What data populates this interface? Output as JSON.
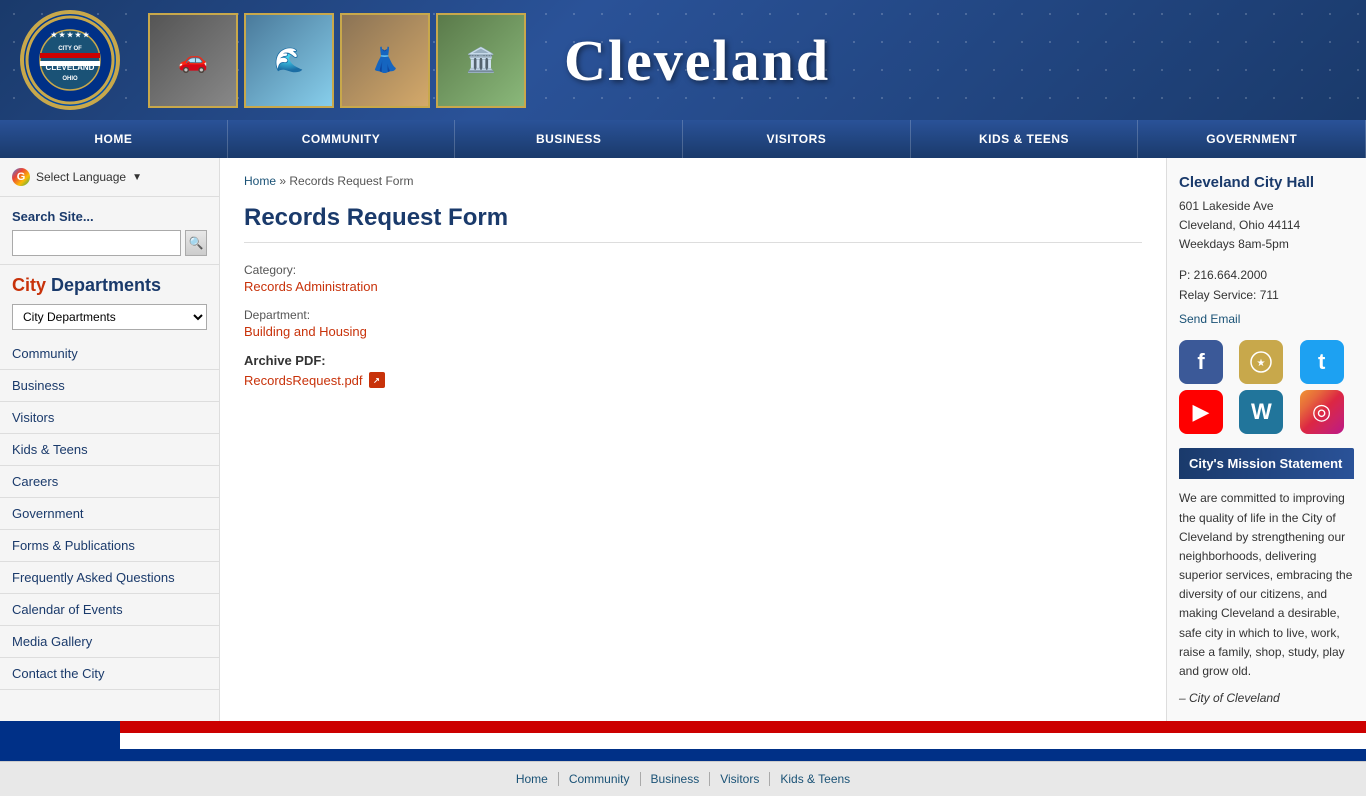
{
  "header": {
    "city_name": "Cleveland",
    "logo_text": "CITY OF\nCLEVELAND\nOHIO"
  },
  "navbar": {
    "items": [
      {
        "label": "HOME",
        "id": "home"
      },
      {
        "label": "COMMUNITY",
        "id": "community"
      },
      {
        "label": "BUSINESS",
        "id": "business"
      },
      {
        "label": "VISITORS",
        "id": "visitors"
      },
      {
        "label": "KIDS & TEENS",
        "id": "kids-teens"
      },
      {
        "label": "GOVERNMENT",
        "id": "government"
      }
    ]
  },
  "sidebar": {
    "language": {
      "label": "Select Language",
      "arrow": "▼"
    },
    "search": {
      "label": "Search Site...",
      "placeholder": ""
    },
    "departments_title": {
      "city": "City",
      "rest": " Departments"
    },
    "dept_dropdown_value": "City Departments",
    "nav_items": [
      {
        "label": "Community",
        "id": "community"
      },
      {
        "label": "Business",
        "id": "business"
      },
      {
        "label": "Visitors",
        "id": "visitors"
      },
      {
        "label": "Kids & Teens",
        "id": "kids-teens"
      },
      {
        "label": "Careers",
        "id": "careers"
      },
      {
        "label": "Government",
        "id": "government"
      },
      {
        "label": "Forms & Publications",
        "id": "forms-publications"
      },
      {
        "label": "Frequently Asked Questions",
        "id": "faq"
      },
      {
        "label": "Calendar of Events",
        "id": "calendar"
      },
      {
        "label": "Media Gallery",
        "id": "media-gallery"
      },
      {
        "label": "Contact the City",
        "id": "contact"
      }
    ]
  },
  "breadcrumb": {
    "home": "Home",
    "separator": "»",
    "current": "Records Request Form"
  },
  "page": {
    "title": "Records Request Form",
    "category_label": "Category:",
    "category_value": "Records Administration",
    "department_label": "Department:",
    "department_value": "Building and Housing",
    "archive_label": "Archive PDF:",
    "archive_file": "RecordsRequest.pdf"
  },
  "right_sidebar": {
    "city_hall_name": "Cleveland City Hall",
    "address_line1": "601 Lakeside Ave",
    "address_line2": "Cleveland, Ohio 44114",
    "hours": "Weekdays 8am-5pm",
    "phone": "P: 216.664.2000",
    "relay": "Relay Service: 711",
    "email_label": "Send Email",
    "social_icons": [
      {
        "name": "facebook",
        "symbol": "f",
        "class": "social-facebook"
      },
      {
        "name": "official-seal",
        "symbol": "★",
        "class": "social-official"
      },
      {
        "name": "twitter",
        "symbol": "t",
        "class": "social-twitter"
      },
      {
        "name": "youtube",
        "symbol": "▶",
        "class": "social-youtube"
      },
      {
        "name": "wordpress",
        "symbol": "W",
        "class": "social-wordpress"
      },
      {
        "name": "instagram",
        "symbol": "◎",
        "class": "social-instagram"
      }
    ],
    "mission_header": "City's Mission Statement",
    "mission_text": "We are committed to improving the quality of life in the City of Cleveland by strengthening our neighborhoods, delivering superior services, embracing the diversity of our citizens, and making Cleveland a desirable, safe city in which to live, work, raise a family, shop, study, play and grow old.",
    "mission_attribution": "– City of Cleveland"
  },
  "footer": {
    "nav_items": [
      {
        "label": "Home"
      },
      {
        "label": "Community"
      },
      {
        "label": "Business"
      },
      {
        "label": "Visitors"
      },
      {
        "label": "Kids & Teens"
      }
    ]
  }
}
